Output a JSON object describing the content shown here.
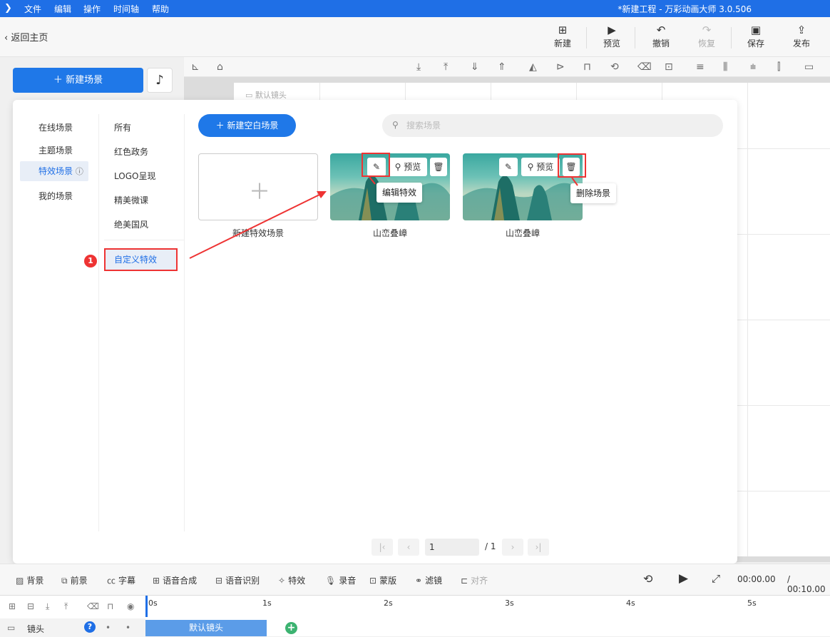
{
  "titlebar": {
    "menus": [
      "文件",
      "编辑",
      "操作",
      "时间轴",
      "帮助"
    ],
    "title": "*新建工程 - 万彩动画大师 3.0.506"
  },
  "toolbar": {
    "back": "返回主页",
    "buttons": [
      {
        "label": "新建",
        "icon": "plus-square-icon"
      },
      {
        "label": "预览",
        "icon": "play-icon"
      },
      {
        "label": "撤销",
        "icon": "undo-icon"
      },
      {
        "label": "恢复",
        "icon": "redo-icon"
      },
      {
        "label": "保存",
        "icon": "save-icon"
      },
      {
        "label": "发布",
        "icon": "publish-icon"
      }
    ]
  },
  "sidebar": {
    "new_scene": "新建场景"
  },
  "stage": {
    "default_shot": "默认镜头"
  },
  "panel": {
    "categories": [
      "在线场景",
      "主题场景",
      "特效场景",
      "我的场景"
    ],
    "active_category": "特效场景",
    "subcategories": [
      "所有",
      "红色政务",
      "LOGO呈现",
      "精美微课",
      "绝美国风"
    ],
    "custom_fx": "自定义特效",
    "badge": "1",
    "new_blank": "新建空白场景",
    "search_placeholder": "搜索场景",
    "cards": [
      {
        "label": "新建特效场景"
      },
      {
        "label": "山峦叠嶂",
        "preview": "预览",
        "tooltip": "编辑特效"
      },
      {
        "label": "山峦叠嶂",
        "preview": "预览",
        "tooltip": "删除场景"
      }
    ],
    "pager": {
      "page": "1",
      "total": "/ 1"
    }
  },
  "bottombar": {
    "tools": [
      {
        "label": "背景",
        "icon": "background-icon"
      },
      {
        "label": "前景",
        "icon": "foreground-icon"
      },
      {
        "label": "字幕",
        "icon": "subtitle-icon"
      },
      {
        "label": "语音合成",
        "icon": "tts-icon"
      },
      {
        "label": "语音识别",
        "icon": "asr-icon"
      },
      {
        "label": "特效",
        "icon": "effects-icon"
      },
      {
        "label": "录音",
        "icon": "mic-icon"
      },
      {
        "label": "蒙版",
        "icon": "mask-icon"
      },
      {
        "label": "滤镜",
        "icon": "filter-icon"
      },
      {
        "label": "对齐",
        "icon": "align-icon"
      }
    ],
    "time_current": "00:00.00",
    "time_total": "/ 00:10.00"
  },
  "timeline": {
    "track_label": "镜头",
    "ruler": [
      "0s",
      "1s",
      "2s",
      "3s",
      "4s",
      "5s"
    ],
    "clip_label": "默认镜头"
  }
}
